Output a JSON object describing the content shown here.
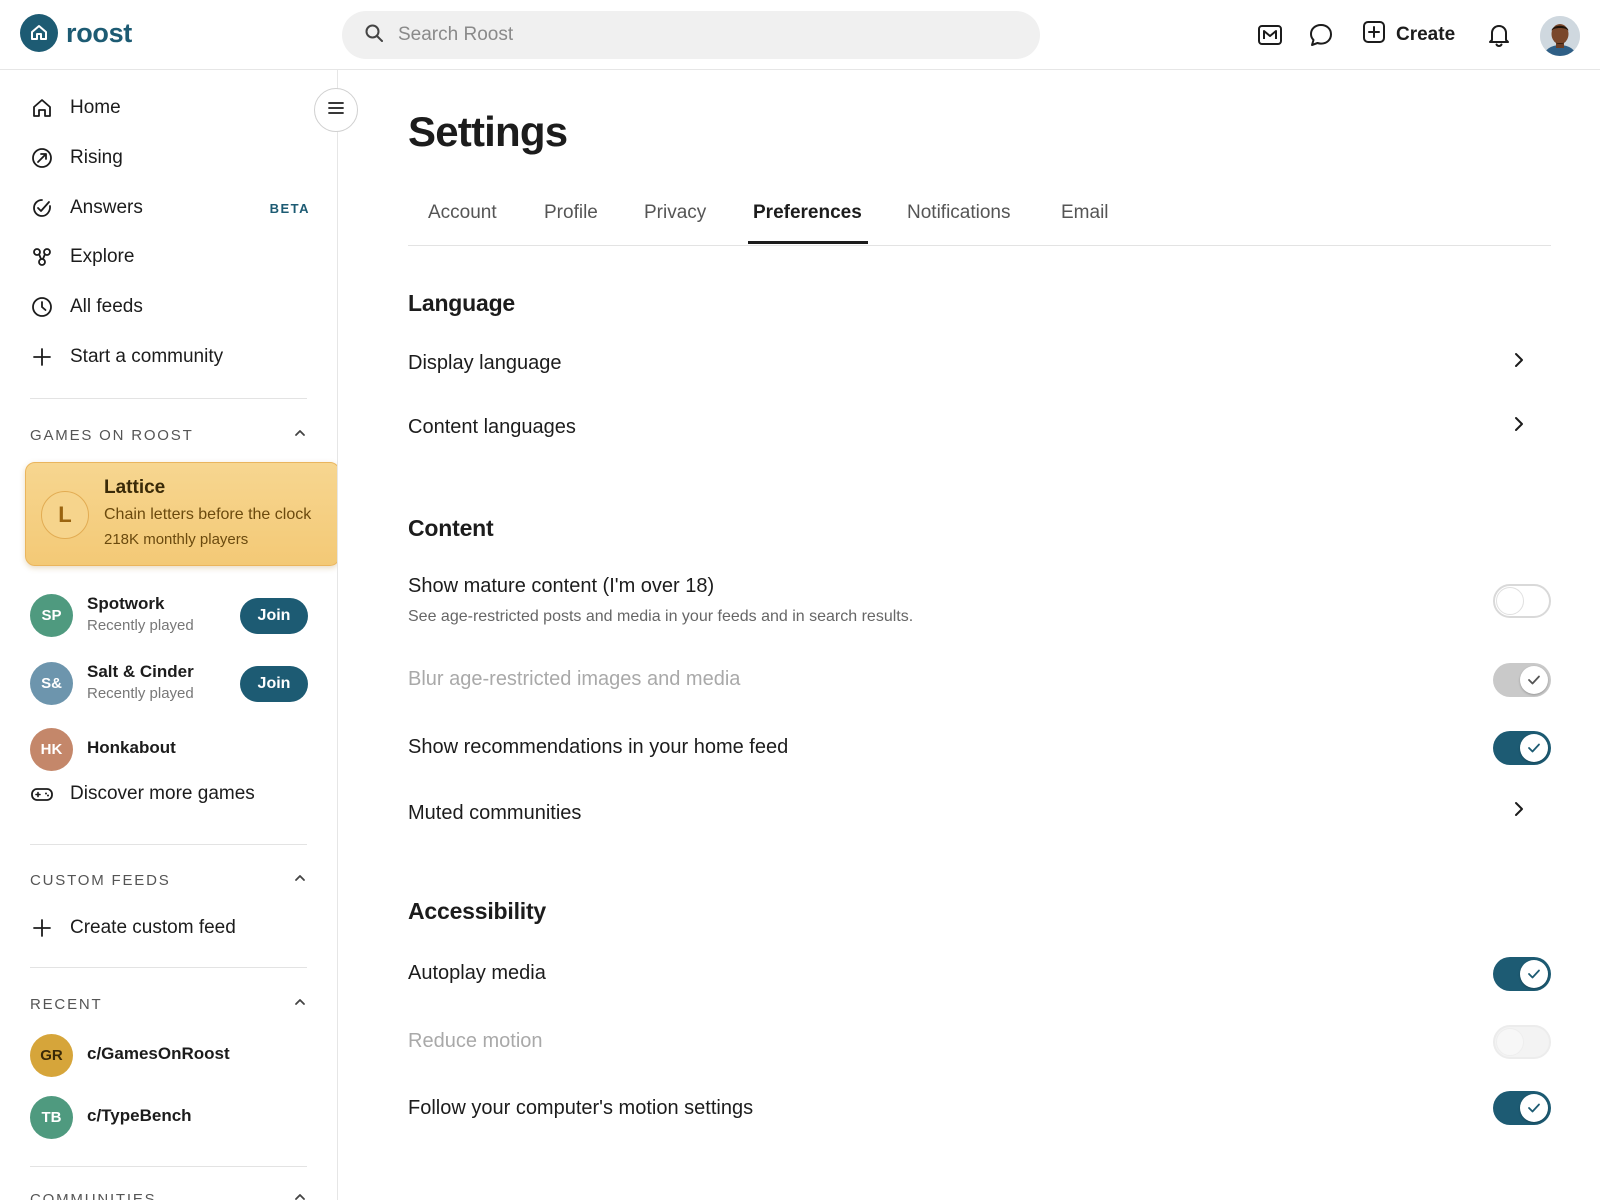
{
  "brand": {
    "name": "roost",
    "color": "#1d5b73"
  },
  "search": {
    "placeholder": "Search Roost"
  },
  "header": {
    "icons": [
      "mod-icon",
      "chat-icon",
      "create-icon",
      "bell-icon"
    ],
    "create_label": "Create"
  },
  "sidebar": {
    "nav": [
      {
        "label": "Home",
        "icon": "home-icon"
      },
      {
        "label": "Rising",
        "icon": "rising-icon"
      },
      {
        "label": "Answers",
        "icon": "answers-icon",
        "badge": "BETA"
      },
      {
        "label": "Explore",
        "icon": "explore-icon"
      },
      {
        "label": "All feeds",
        "icon": "clock-icon"
      },
      {
        "label": "Start a community",
        "icon": "plus-icon"
      }
    ],
    "games_header": "GAMES ON ROOST",
    "featured_game": {
      "initial": "L",
      "name": "Lattice",
      "tagline": "Chain letters before the clock",
      "players": "218K monthly players"
    },
    "games": [
      {
        "initials": "SP",
        "name": "Spotwork",
        "sub": "Recently played",
        "action": "Join",
        "color": "#4f9a7f"
      },
      {
        "initials": "S&",
        "name": "Salt & Cinder",
        "sub": "Recently played",
        "action": "Join",
        "color": "#6d95ad"
      },
      {
        "initials": "HK",
        "name": "Honkabout",
        "sub": "",
        "action": "",
        "color": "#c4876a"
      }
    ],
    "discover_label": "Discover more games",
    "custom_feeds_header": "CUSTOM FEEDS",
    "create_feed_label": "Create custom feed",
    "recent_header": "RECENT",
    "recent": [
      {
        "initials": "GR",
        "name": "c/GamesOnRoost",
        "color": "#d6a53a"
      },
      {
        "initials": "TB",
        "name": "c/TypeBench",
        "color": "#4f9a7f"
      }
    ],
    "communities_header": "COMMUNITIES"
  },
  "main": {
    "title": "Settings",
    "tabs": [
      "Account",
      "Profile",
      "Privacy",
      "Preferences",
      "Notifications",
      "Email"
    ],
    "active_tab": "Preferences",
    "sections": {
      "language": {
        "title": "Language",
        "rows": [
          {
            "label": "Display language",
            "control": "chevron"
          },
          {
            "label": "Content languages",
            "control": "chevron"
          }
        ]
      },
      "content": {
        "title": "Content",
        "rows": [
          {
            "label": "Show mature content (I'm over 18)",
            "description": "See age-restricted posts and media in your feeds and in search results.",
            "control": "toggle",
            "state": "off"
          },
          {
            "label": "Blur age-restricted images and media",
            "control": "toggle",
            "state": "on-disabled"
          },
          {
            "label": "Show recommendations in your home feed",
            "control": "toggle",
            "state": "on"
          },
          {
            "label": "Muted communities",
            "control": "chevron"
          }
        ]
      },
      "accessibility": {
        "title": "Accessibility",
        "rows": [
          {
            "label": "Autoplay media",
            "control": "toggle",
            "state": "on"
          },
          {
            "label": "Reduce motion",
            "control": "toggle",
            "state": "off-disabled"
          },
          {
            "label": "Follow your computer's motion settings",
            "control": "toggle",
            "state": "on"
          }
        ]
      }
    }
  }
}
